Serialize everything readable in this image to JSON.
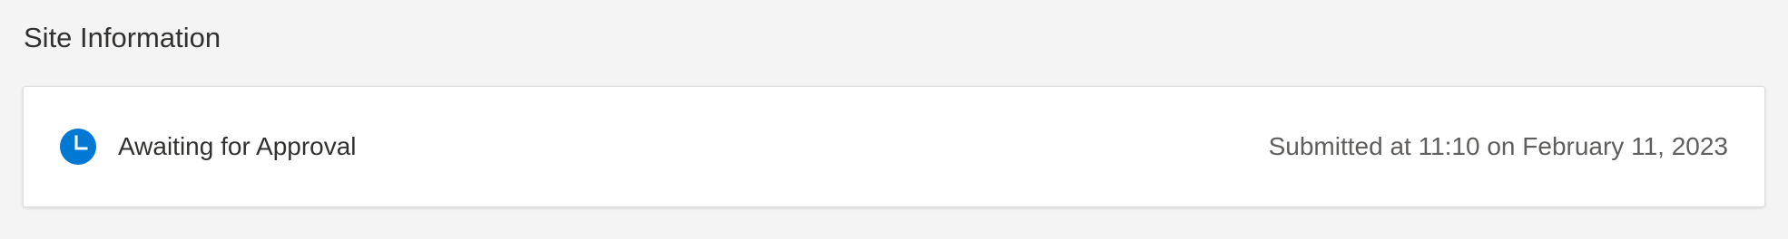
{
  "section": {
    "title": "Site Information"
  },
  "status_card": {
    "icon": "clock-icon",
    "status": "Awaiting for Approval",
    "submitted": "Submitted at 11:10 on February 11, 2023"
  },
  "colors": {
    "accent": "#0078d4",
    "background": "#f4f4f4",
    "card": "#ffffff",
    "primary_text": "#323130",
    "secondary_text": "#605e5c"
  }
}
